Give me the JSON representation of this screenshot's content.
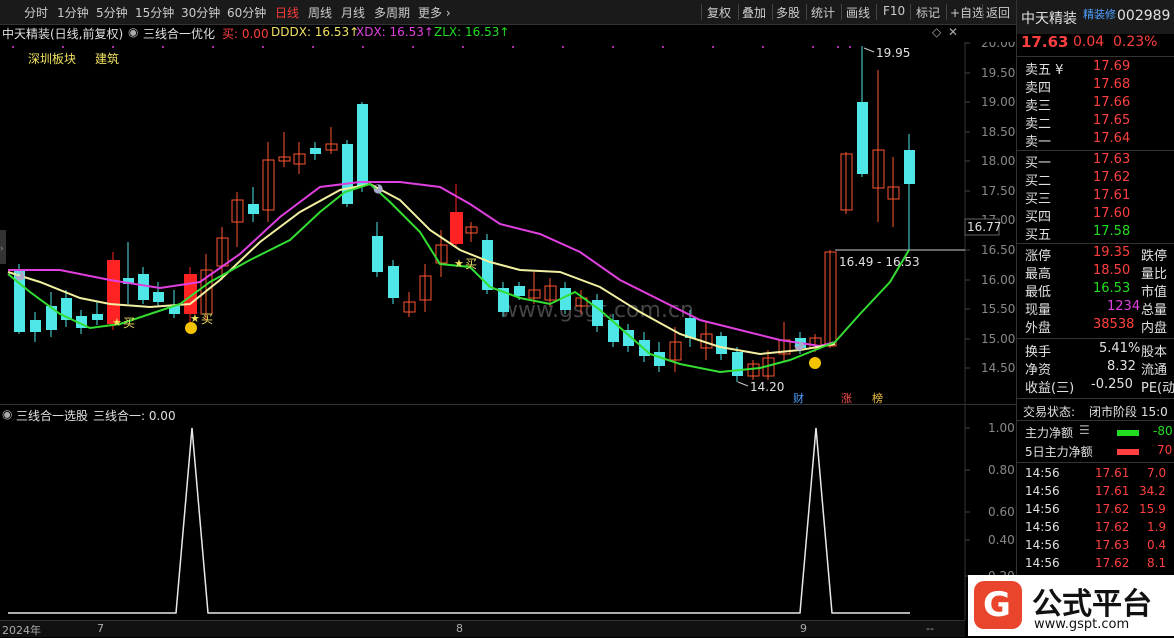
{
  "toolbar": {
    "timeframes": [
      "分时",
      "1分钟",
      "5分钟",
      "15分钟",
      "30分钟",
      "60分钟",
      "日线",
      "周线",
      "月线",
      "多周期",
      "更多 ›"
    ],
    "active_timeframe": "日线",
    "right_buttons": [
      "复权",
      "叠加",
      "多股",
      "统计",
      "画线",
      "F10",
      "标记",
      "+自选",
      "返回"
    ]
  },
  "chart_header": {
    "stock_label": "中天精装(日线,前复权)",
    "indicator_name": "三线合一优化",
    "buy_label": "买: 0.00",
    "dddx_label": "DDDX: 16.53↑",
    "xdx_label": "XDX: 16.53↑",
    "zlx_label": "ZLX: 16.53↑",
    "board": "深圳板块",
    "industry": "建筑"
  },
  "main_chart": {
    "price_axis": [
      "20.00",
      "19.50",
      "19.00",
      "18.50",
      "18.00",
      "17.50",
      "17.00",
      "16.50",
      "16.00",
      "15.50",
      "15.00",
      "14.50"
    ],
    "current_price_tag": "16.77",
    "high_annotation": "19.95",
    "low_annotation": "14.20",
    "range_annotation": "16.49 - 16.53",
    "buy_marker": "买",
    "watermark": "www.gsgt.com.cn",
    "events": [
      "财",
      "涨",
      "榜"
    ],
    "xdx_level": "16.53"
  },
  "sub_chart": {
    "title": "三线合一选股",
    "value_label": "三线合一: 0.00",
    "axis": [
      "1.00",
      "0.80",
      "0.60",
      "0.40",
      "0.20"
    ]
  },
  "bottom_axis": {
    "year": "2024年",
    "months": [
      "7",
      "8",
      "9"
    ],
    "minus": "--"
  },
  "right_panel": {
    "name": "中天精装",
    "tag": "精装修",
    "code": "002989",
    "price": "17.63",
    "change": "0.04",
    "change_pct": "0.23%",
    "asks": [
      {
        "label": "卖五 ¥",
        "price": "17.69"
      },
      {
        "label": "卖四",
        "price": "17.68"
      },
      {
        "label": "卖三",
        "price": "17.66"
      },
      {
        "label": "卖二",
        "price": "17.65"
      },
      {
        "label": "卖一",
        "price": "17.64"
      }
    ],
    "bids": [
      {
        "label": "买一",
        "price": "17.63"
      },
      {
        "label": "买二",
        "price": "17.62"
      },
      {
        "label": "买三",
        "price": "17.61"
      },
      {
        "label": "买四",
        "price": "17.60"
      },
      {
        "label": "买五",
        "price": "17.58"
      }
    ],
    "stats": [
      {
        "label": "涨停",
        "value": "19.35",
        "label2": "跌停"
      },
      {
        "label": "最高",
        "value": "18.50",
        "label2": "量比"
      },
      {
        "label": "最低",
        "value": "16.53",
        "label2": "市值"
      },
      {
        "label": "现量",
        "value": "1234",
        "label2": "总量"
      },
      {
        "label": "外盘",
        "value": "38538",
        "label2": "内盘"
      }
    ],
    "stats2": [
      {
        "label": "换手",
        "value": "5.41%",
        "label2": "股本"
      },
      {
        "label": "净资",
        "value": "8.32",
        "label2": "流通"
      },
      {
        "label": "收益(三)",
        "value": "-0.250",
        "label2": "PE(动"
      }
    ],
    "trade_status_label": "交易状态:",
    "trade_status": "闭市阶段 15:0",
    "main_net": "主力净额",
    "main_net_val": "-80",
    "main5_net": "5日主力净额",
    "main5_net_val": "70",
    "ticks": [
      {
        "time": "14:56",
        "price": "17.61",
        "vol": "7.0"
      },
      {
        "time": "14:56",
        "price": "17.61",
        "vol": "34.2"
      },
      {
        "time": "14:56",
        "price": "17.62",
        "vol": "15.9"
      },
      {
        "time": "14:56",
        "price": "17.62",
        "vol": "1.9"
      },
      {
        "time": "14:56",
        "price": "17.63",
        "vol": "0.4"
      },
      {
        "time": "14:56",
        "price": "17.62",
        "vol": "8.1"
      }
    ]
  },
  "logo": {
    "brand": "公式平台",
    "url": "www.gspt.com"
  }
}
